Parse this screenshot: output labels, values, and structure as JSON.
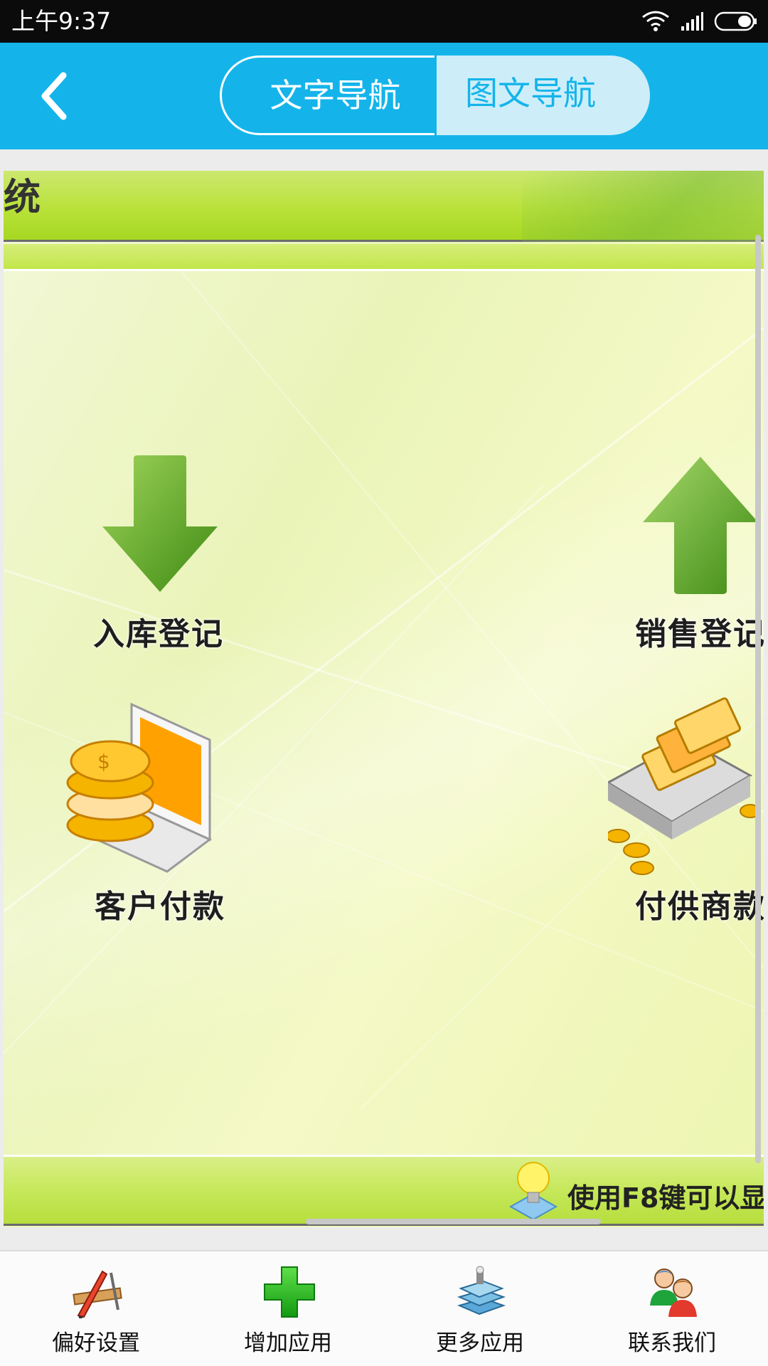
{
  "status_bar": {
    "time": "上午9:37",
    "icons": [
      "wifi-icon",
      "signal-icon",
      "battery-icon"
    ]
  },
  "header": {
    "back_icon": "chevron-left-icon",
    "tabs": [
      {
        "label": "文字导航",
        "selected": false
      },
      {
        "label": "图文导航",
        "selected": true
      }
    ],
    "colors": {
      "bar": "#14b4ea",
      "selected_tab_bg": "#cdeef9"
    }
  },
  "content": {
    "banner_title_fragment": "统",
    "apps": [
      {
        "label": "入库登记",
        "icon": "arrow-down-icon"
      },
      {
        "label": "销售登记",
        "icon": "arrow-up-icon"
      },
      {
        "label": "客户付款",
        "icon": "coins-laptop-icon"
      },
      {
        "label": "付供商款",
        "icon": "money-box-icon"
      }
    ],
    "tip": {
      "icon": "lightbulb-icon",
      "text": "使用F8键可以显"
    }
  },
  "bottom_nav": [
    {
      "label": "偏好设置",
      "icon": "design-tools-icon"
    },
    {
      "label": "增加应用",
      "icon": "plus-icon"
    },
    {
      "label": "更多应用",
      "icon": "stacked-books-icon"
    },
    {
      "label": "联系我们",
      "icon": "people-icon"
    }
  ]
}
